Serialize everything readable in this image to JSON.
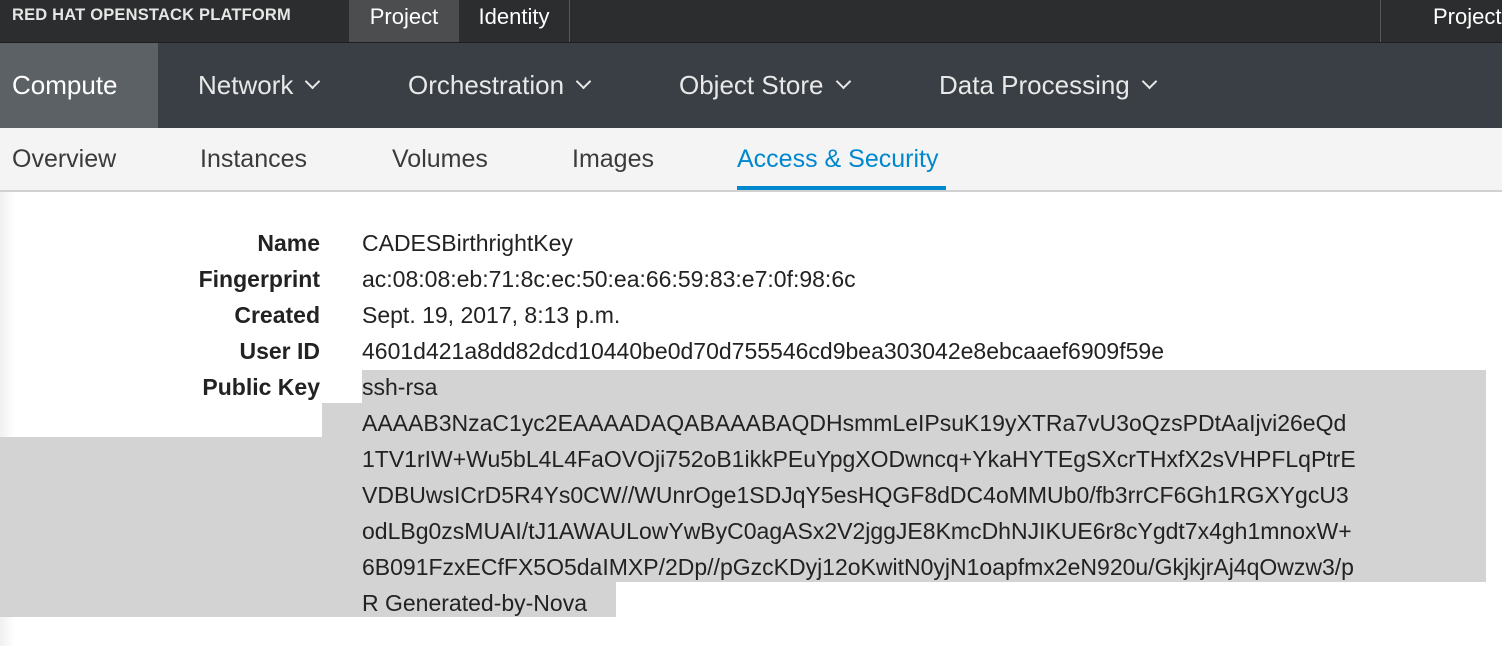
{
  "brand": "RED HAT OPENSTACK PLATFORM",
  "top_tabs": [
    {
      "label": "Project"
    },
    {
      "label": "Identity"
    }
  ],
  "top_right": {
    "label": "Project"
  },
  "nav2": [
    {
      "label": "Compute"
    },
    {
      "label": "Network"
    },
    {
      "label": "Orchestration"
    },
    {
      "label": "Object Store"
    },
    {
      "label": "Data Processing"
    }
  ],
  "nav3": [
    {
      "label": "Overview"
    },
    {
      "label": "Instances"
    },
    {
      "label": "Volumes"
    },
    {
      "label": "Images"
    },
    {
      "label": "Access & Security"
    }
  ],
  "details": {
    "name_label": "Name",
    "name_value": "CADESBirthrightKey",
    "fingerprint_label": "Fingerprint",
    "fingerprint_value": "ac:08:08:eb:71:8c:ec:50:ea:66:59:83:e7:0f:98:6c",
    "created_label": "Created",
    "created_value": "Sept. 19, 2017, 8:13 p.m.",
    "userid_label": "User ID",
    "userid_value": "4601d421a8dd82dcd10440be0d70d755546cd9bea303042e8ebcaaef6909f59e",
    "publickey_label": "Public Key",
    "publickey_lines": [
      "ssh-rsa",
      "AAAAB3NzaC1yc2EAAAADAQABAAABAQDHsmmLeIPsuK19yXTRa7vU3oQzsPDtAaIjvi26eQd",
      "1TV1rIW+Wu5bL4L4FaOVOji752oB1ikkPEuYpgXODwncq+YkaHYTEgSXcrTHxfX2sVHPFLqPtrE",
      "VDBUwsICrD5R4Ys0CW//WUnrOge1SDJqY5esHQGF8dDC4oMMUb0/fb3rrCF6Gh1RGXYgcU3",
      "odLBg0zsMUAI/tJ1AWAULowYwByC0agASx2V2jggJE8KmcDhNJIKUE6r8cYgdt7x4gh1mnoxW+",
      "6B091FzxECfFX5O5daIMXP/2Dp//pGzcKDyj12oKwitN0yjN1oapfmx2eN920u/GkjkjrAj4qOwzw3/p",
      "R Generated-by-Nova"
    ]
  }
}
